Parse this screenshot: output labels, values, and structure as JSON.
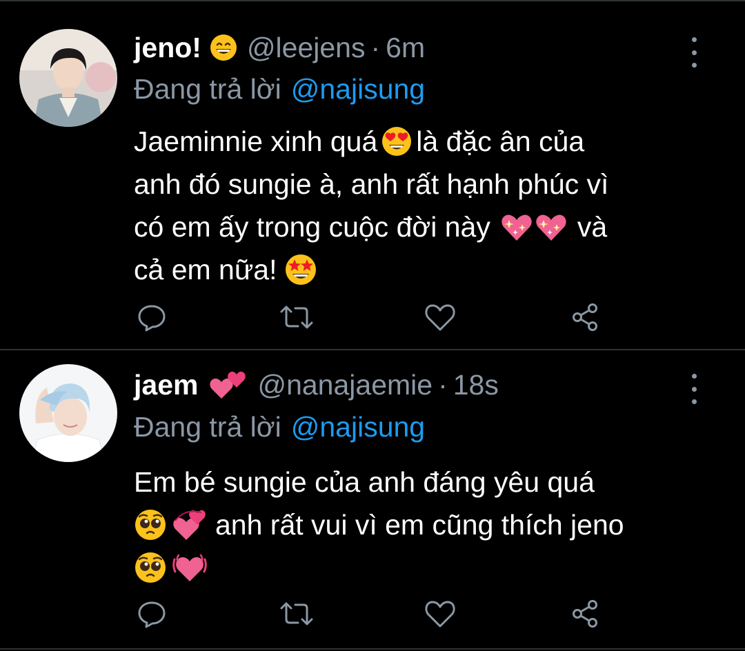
{
  "colors": {
    "background": "#000000",
    "text": "#ffffff",
    "secondary": "#8b98a5",
    "link": "#1d9bf0",
    "divider": "#2f3336"
  },
  "tweets": [
    {
      "display_name": "jeno!",
      "name_emoji": "grinning-face-emoji",
      "handle": "@leejens",
      "separator": "·",
      "time": "6m",
      "reply_prefix": "Đang trả lời",
      "reply_to": "@najisung",
      "body_lines": [
        {
          "a": "Jaeminnie xinh quá",
          "b": "là đặc ân của"
        },
        {
          "a": "anh đó sungie à, anh rất hạnh phúc vì"
        },
        {
          "a": "có em ấy trong cuộc đời này",
          "b": "và"
        },
        {
          "a": "cả em nữa!"
        }
      ],
      "emojis": [
        "heart-eyes-emoji",
        "sparkling-heart-emoji",
        "sparkling-heart-emoji",
        "star-struck-emoji"
      ]
    },
    {
      "display_name": "jaem",
      "name_emoji": "two-hearts-emoji",
      "handle": "@nanajaemie",
      "separator": "·",
      "time": "18s",
      "reply_prefix": "Đang trả lời",
      "reply_to": "@najisung",
      "body_lines": [
        {
          "a": "Em bé sungie của anh đáng yêu quá"
        },
        {
          "a": "anh rất vui vì em cũng thích jeno"
        },
        {
          "a": ""
        }
      ],
      "emojis": [
        "pleading-face-emoji",
        "revolving-hearts-emoji",
        "pleading-face-emoji",
        "beating-heart-emoji"
      ]
    }
  ],
  "action_icons": [
    "reply-icon",
    "retweet-icon",
    "like-icon",
    "share-icon"
  ]
}
